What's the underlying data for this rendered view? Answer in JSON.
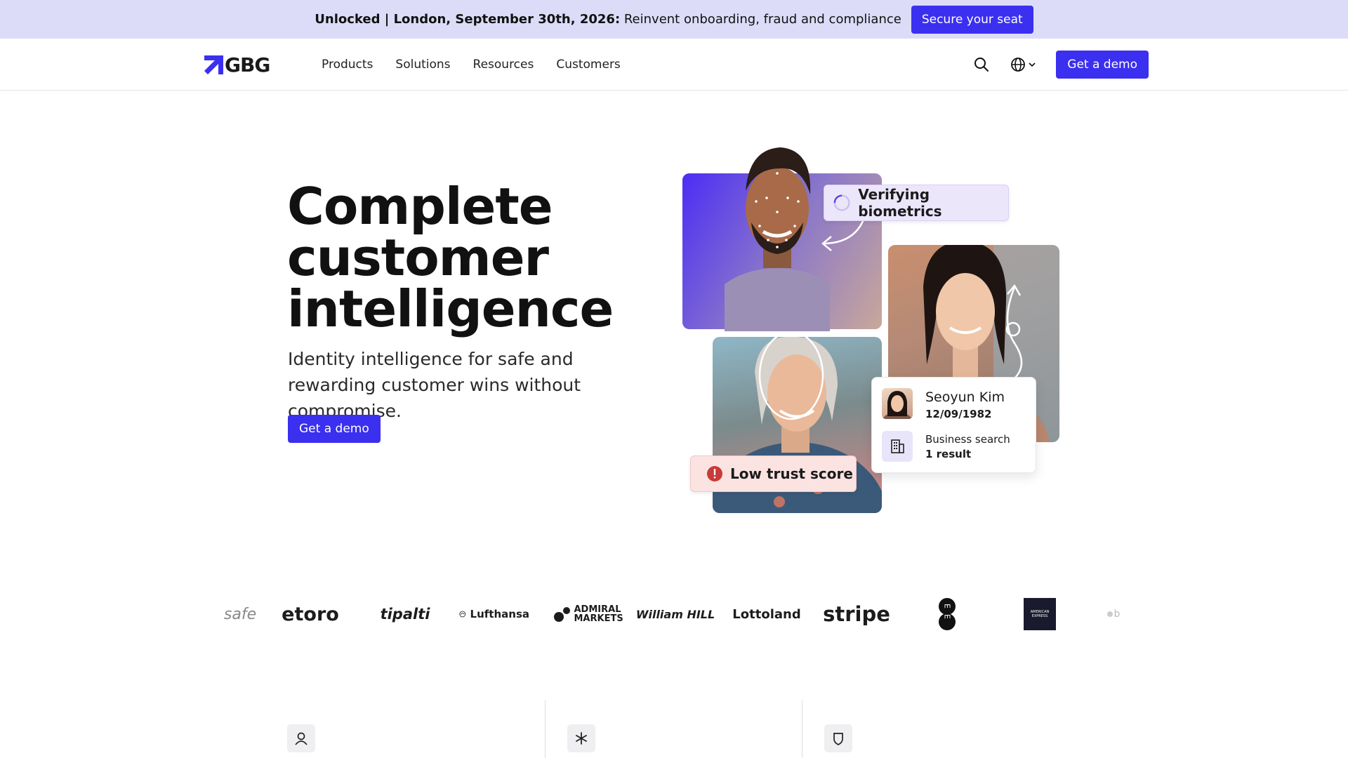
{
  "announcement": {
    "bold_text": "Unlocked | London, September 30th, 2026:",
    "text": " Reinvent onboarding, fraud and compliance",
    "cta_label": "Secure your seat"
  },
  "nav": {
    "logo_text": "GBG",
    "links": [
      "Products",
      "Solutions",
      "Resources",
      "Customers"
    ],
    "cta_label": "Get a demo",
    "icons": [
      "search-icon",
      "globe-icon",
      "chevron-down-icon"
    ]
  },
  "hero": {
    "title_lines": [
      "Complete",
      "customer",
      "intelligence"
    ],
    "subtitle": "Identity intelligence for safe and rewarding customer wins without compromise.",
    "cta_label": "Get a demo"
  },
  "visual": {
    "verify_badge": "Verifying biometrics",
    "trust_badge": "Low trust score",
    "profile_card": {
      "name": "Seoyun Kim",
      "dob": "12/09/1982",
      "business_search_label": "Business search",
      "business_search_result": "1 result"
    }
  },
  "customer_logos": [
    "safe",
    "etoro",
    "tipalti",
    "Lufthansa",
    "ADMIRAL MARKETS",
    "William HILL",
    "Lottoland",
    "stripe",
    "EE",
    "AMERICAN EXPRESS",
    "b"
  ],
  "features": {
    "icons": [
      "user-icon",
      "asterisk-icon",
      "shield-icon"
    ]
  },
  "colors": {
    "accent": "#3b2ff0",
    "announcement_bg": "#dcdcf8",
    "verify_bg": "#ece6fb",
    "trust_bg": "#fbe3e2",
    "alert_red": "#c93a3a"
  }
}
